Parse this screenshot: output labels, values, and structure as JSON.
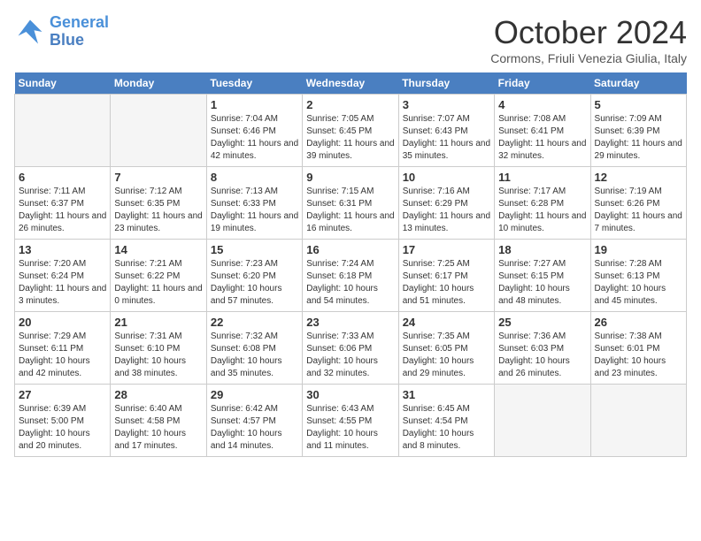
{
  "header": {
    "logo_line1": "General",
    "logo_line2": "Blue",
    "month": "October 2024",
    "location": "Cormons, Friuli Venezia Giulia, Italy"
  },
  "weekdays": [
    "Sunday",
    "Monday",
    "Tuesday",
    "Wednesday",
    "Thursday",
    "Friday",
    "Saturday"
  ],
  "weeks": [
    [
      {
        "day": "",
        "info": ""
      },
      {
        "day": "",
        "info": ""
      },
      {
        "day": "1",
        "info": "Sunrise: 7:04 AM\nSunset: 6:46 PM\nDaylight: 11 hours and 42 minutes."
      },
      {
        "day": "2",
        "info": "Sunrise: 7:05 AM\nSunset: 6:45 PM\nDaylight: 11 hours and 39 minutes."
      },
      {
        "day": "3",
        "info": "Sunrise: 7:07 AM\nSunset: 6:43 PM\nDaylight: 11 hours and 35 minutes."
      },
      {
        "day": "4",
        "info": "Sunrise: 7:08 AM\nSunset: 6:41 PM\nDaylight: 11 hours and 32 minutes."
      },
      {
        "day": "5",
        "info": "Sunrise: 7:09 AM\nSunset: 6:39 PM\nDaylight: 11 hours and 29 minutes."
      }
    ],
    [
      {
        "day": "6",
        "info": "Sunrise: 7:11 AM\nSunset: 6:37 PM\nDaylight: 11 hours and 26 minutes."
      },
      {
        "day": "7",
        "info": "Sunrise: 7:12 AM\nSunset: 6:35 PM\nDaylight: 11 hours and 23 minutes."
      },
      {
        "day": "8",
        "info": "Sunrise: 7:13 AM\nSunset: 6:33 PM\nDaylight: 11 hours and 19 minutes."
      },
      {
        "day": "9",
        "info": "Sunrise: 7:15 AM\nSunset: 6:31 PM\nDaylight: 11 hours and 16 minutes."
      },
      {
        "day": "10",
        "info": "Sunrise: 7:16 AM\nSunset: 6:29 PM\nDaylight: 11 hours and 13 minutes."
      },
      {
        "day": "11",
        "info": "Sunrise: 7:17 AM\nSunset: 6:28 PM\nDaylight: 11 hours and 10 minutes."
      },
      {
        "day": "12",
        "info": "Sunrise: 7:19 AM\nSunset: 6:26 PM\nDaylight: 11 hours and 7 minutes."
      }
    ],
    [
      {
        "day": "13",
        "info": "Sunrise: 7:20 AM\nSunset: 6:24 PM\nDaylight: 11 hours and 3 minutes."
      },
      {
        "day": "14",
        "info": "Sunrise: 7:21 AM\nSunset: 6:22 PM\nDaylight: 11 hours and 0 minutes."
      },
      {
        "day": "15",
        "info": "Sunrise: 7:23 AM\nSunset: 6:20 PM\nDaylight: 10 hours and 57 minutes."
      },
      {
        "day": "16",
        "info": "Sunrise: 7:24 AM\nSunset: 6:18 PM\nDaylight: 10 hours and 54 minutes."
      },
      {
        "day": "17",
        "info": "Sunrise: 7:25 AM\nSunset: 6:17 PM\nDaylight: 10 hours and 51 minutes."
      },
      {
        "day": "18",
        "info": "Sunrise: 7:27 AM\nSunset: 6:15 PM\nDaylight: 10 hours and 48 minutes."
      },
      {
        "day": "19",
        "info": "Sunrise: 7:28 AM\nSunset: 6:13 PM\nDaylight: 10 hours and 45 minutes."
      }
    ],
    [
      {
        "day": "20",
        "info": "Sunrise: 7:29 AM\nSunset: 6:11 PM\nDaylight: 10 hours and 42 minutes."
      },
      {
        "day": "21",
        "info": "Sunrise: 7:31 AM\nSunset: 6:10 PM\nDaylight: 10 hours and 38 minutes."
      },
      {
        "day": "22",
        "info": "Sunrise: 7:32 AM\nSunset: 6:08 PM\nDaylight: 10 hours and 35 minutes."
      },
      {
        "day": "23",
        "info": "Sunrise: 7:33 AM\nSunset: 6:06 PM\nDaylight: 10 hours and 32 minutes."
      },
      {
        "day": "24",
        "info": "Sunrise: 7:35 AM\nSunset: 6:05 PM\nDaylight: 10 hours and 29 minutes."
      },
      {
        "day": "25",
        "info": "Sunrise: 7:36 AM\nSunset: 6:03 PM\nDaylight: 10 hours and 26 minutes."
      },
      {
        "day": "26",
        "info": "Sunrise: 7:38 AM\nSunset: 6:01 PM\nDaylight: 10 hours and 23 minutes."
      }
    ],
    [
      {
        "day": "27",
        "info": "Sunrise: 6:39 AM\nSunset: 5:00 PM\nDaylight: 10 hours and 20 minutes."
      },
      {
        "day": "28",
        "info": "Sunrise: 6:40 AM\nSunset: 4:58 PM\nDaylight: 10 hours and 17 minutes."
      },
      {
        "day": "29",
        "info": "Sunrise: 6:42 AM\nSunset: 4:57 PM\nDaylight: 10 hours and 14 minutes."
      },
      {
        "day": "30",
        "info": "Sunrise: 6:43 AM\nSunset: 4:55 PM\nDaylight: 10 hours and 11 minutes."
      },
      {
        "day": "31",
        "info": "Sunrise: 6:45 AM\nSunset: 4:54 PM\nDaylight: 10 hours and 8 minutes."
      },
      {
        "day": "",
        "info": ""
      },
      {
        "day": "",
        "info": ""
      }
    ]
  ]
}
